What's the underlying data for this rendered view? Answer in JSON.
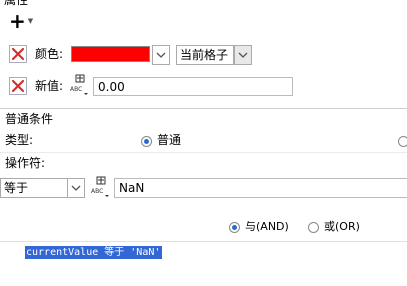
{
  "section_title": "属性",
  "toolbar": {
    "add_icon": "plus-icon",
    "dropdown_icon": "caret-down-icon"
  },
  "attributes": {
    "color": {
      "label": "颜色:",
      "value_color": "#ff0000",
      "scope": "当前格子"
    },
    "new_value": {
      "label": "新值:",
      "value": "0.00"
    }
  },
  "condition": {
    "section_title": "普通条件",
    "type_label": "类型:",
    "type_option": "普通",
    "operator_label": "操作符:",
    "operator": "等于",
    "operand": "NaN",
    "logic_and": "与(AND)",
    "logic_or": "或(OR)",
    "expression": "currentValue 等于 'NaN'"
  },
  "colors": {
    "selection": "#3367d6",
    "delete_red": "#d03030",
    "radio_dot": "#2a6ad4"
  }
}
